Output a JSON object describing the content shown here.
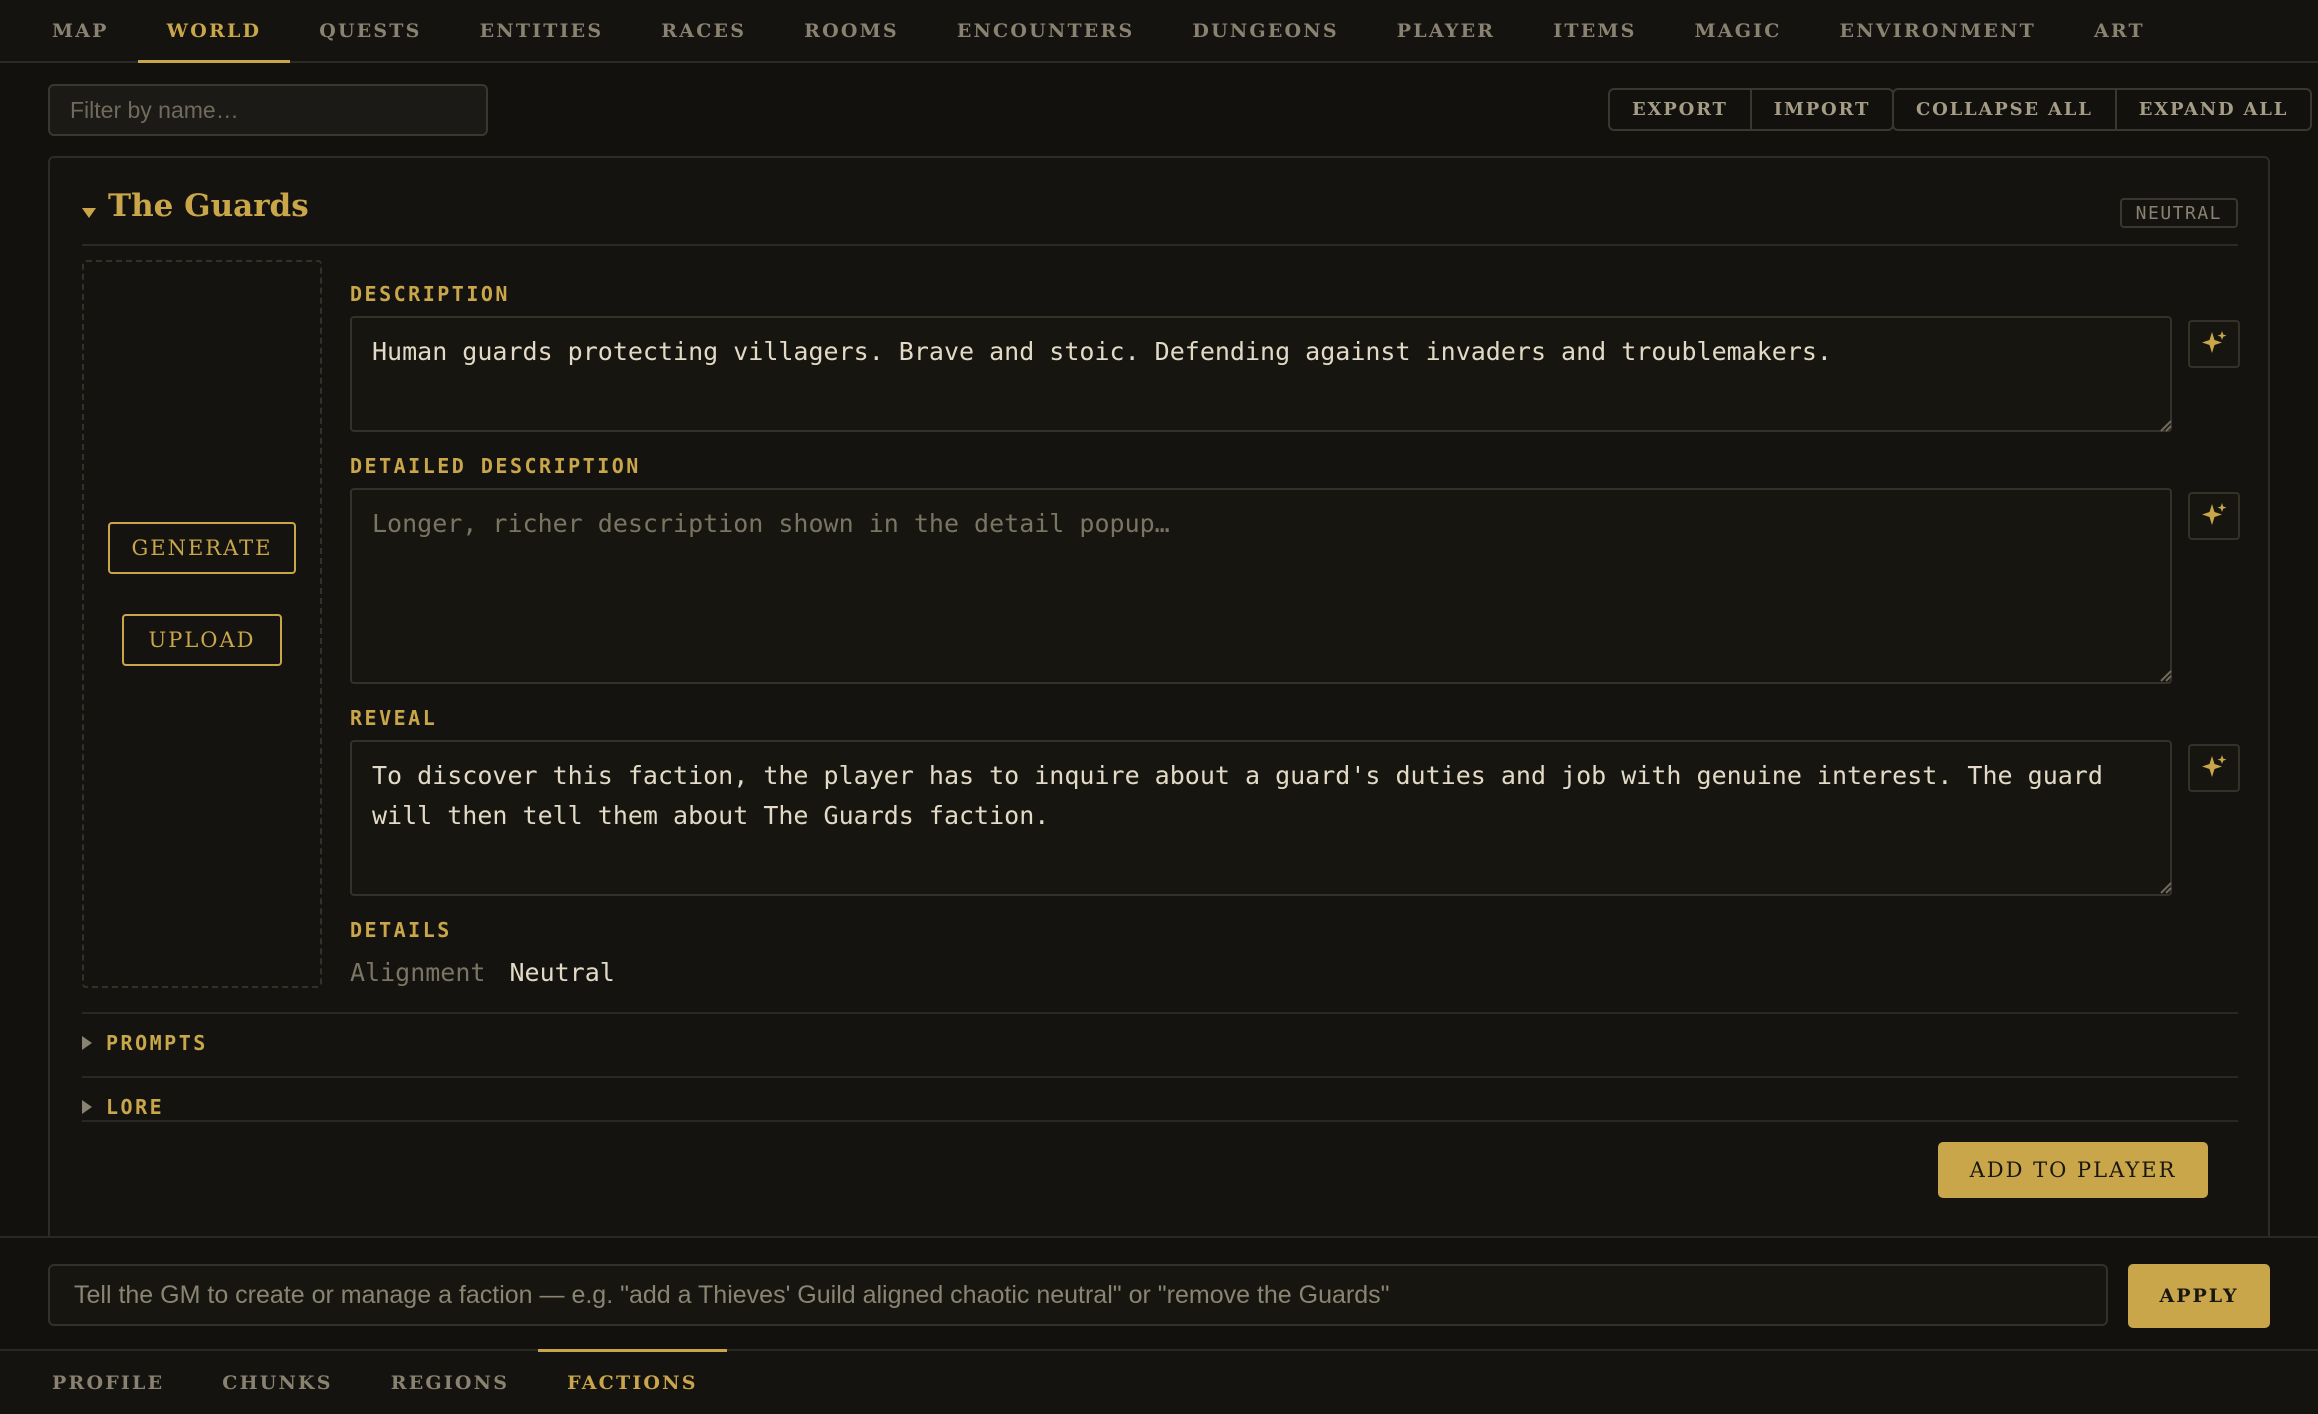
{
  "top_nav": {
    "tabs": [
      {
        "label": "MAP",
        "active": false
      },
      {
        "label": "WORLD",
        "active": true
      },
      {
        "label": "QUESTS",
        "active": false
      },
      {
        "label": "ENTITIES",
        "active": false
      },
      {
        "label": "RACES",
        "active": false
      },
      {
        "label": "ROOMS",
        "active": false
      },
      {
        "label": "ENCOUNTERS",
        "active": false
      },
      {
        "label": "DUNGEONS",
        "active": false
      },
      {
        "label": "PLAYER",
        "active": false
      },
      {
        "label": "ITEMS",
        "active": false
      },
      {
        "label": "MAGIC",
        "active": false
      },
      {
        "label": "ENVIRONMENT",
        "active": false
      },
      {
        "label": "ART",
        "active": false
      }
    ]
  },
  "toolbar": {
    "filter_placeholder": "Filter by name…",
    "export_label": "EXPORT",
    "import_label": "IMPORT",
    "collapse_all_label": "COLLAPSE ALL",
    "expand_all_label": "EXPAND ALL"
  },
  "faction": {
    "title": "The Guards",
    "badge": "NEUTRAL",
    "generate_label": "GENERATE",
    "upload_label": "UPLOAD",
    "description_label": "DESCRIPTION",
    "description_value": "Human guards protecting villagers. Brave and stoic. Defending against invaders and troublemakers.",
    "detailed_description_label": "DETAILED DESCRIPTION",
    "detailed_description_value": "",
    "detailed_description_placeholder": "Longer, richer description shown in the detail popup…",
    "reveal_label": "REVEAL",
    "reveal_value": "To discover this faction, the player has to inquire about a guard's duties and job with genuine interest. The guard will then tell them about The Guards faction.",
    "details_label": "DETAILS",
    "alignment_key": "Alignment",
    "alignment_value": "Neutral",
    "prompts_label": "PROMPTS",
    "lore_label": "LORE",
    "add_to_player_label": "ADD TO PLAYER"
  },
  "command_bar": {
    "placeholder": "Tell the GM to create or manage a faction — e.g. \"add a Thieves' Guild aligned chaotic neutral\" or \"remove the Guards\"",
    "apply_label": "APPLY"
  },
  "bottom_nav": {
    "tabs": [
      {
        "label": "PROFILE",
        "active": false
      },
      {
        "label": "CHUNKS",
        "active": false
      },
      {
        "label": "REGIONS",
        "active": false
      },
      {
        "label": "FACTIONS",
        "active": true
      }
    ]
  },
  "icons": {
    "sparkle": "sparkle-icon",
    "expand": "caret-down-icon",
    "collapse": "caret-right-icon"
  },
  "colors": {
    "accent": "#c9a64a",
    "background": "#12110e",
    "muted_text": "#8a8270"
  }
}
